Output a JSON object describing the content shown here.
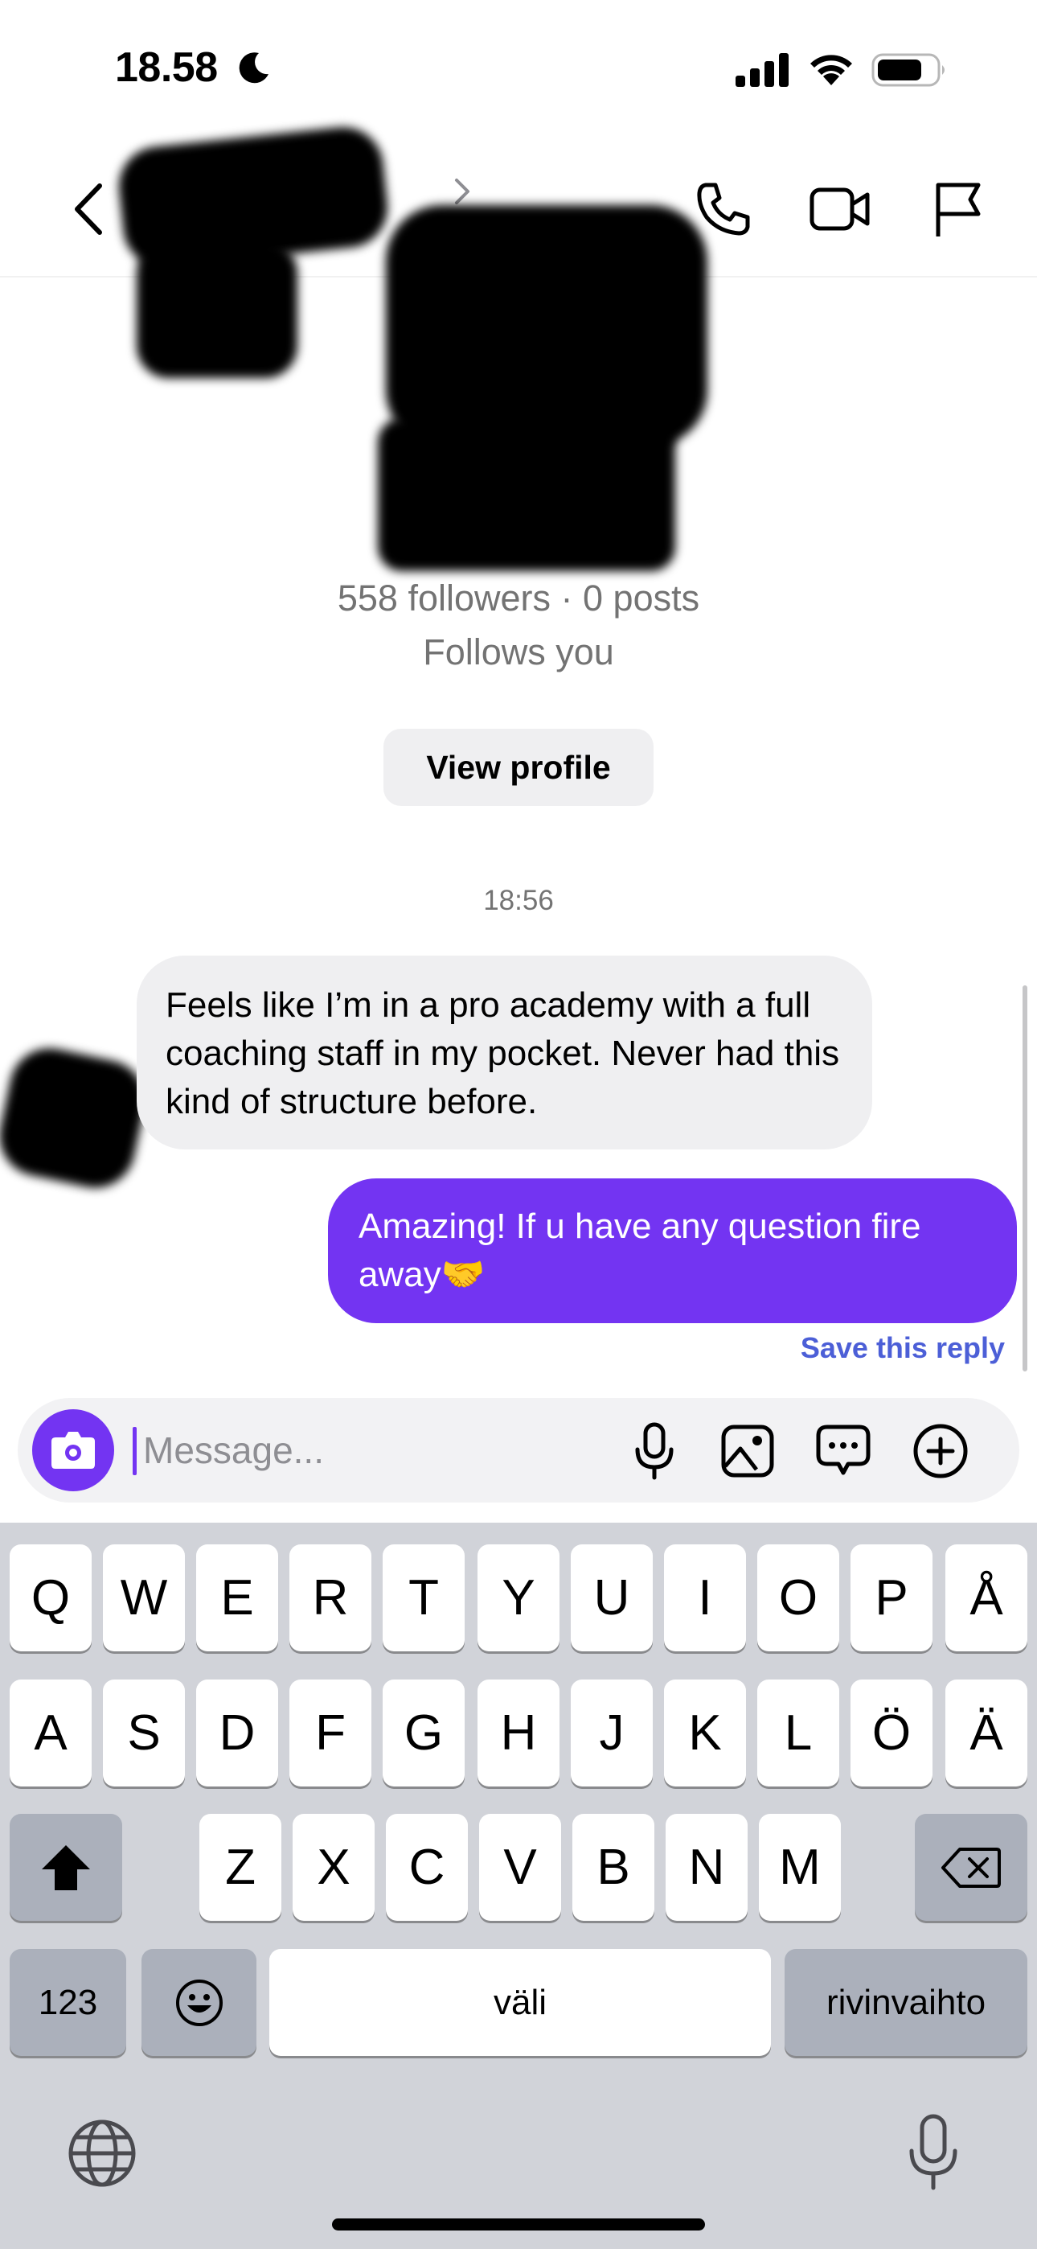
{
  "status_bar": {
    "time": "18.58",
    "icons": [
      "moon-icon",
      "signal-icon",
      "wifi-icon",
      "battery-icon"
    ]
  },
  "header": {
    "icons": [
      "back-chevron-icon",
      "phone-icon",
      "video-camera-icon",
      "flag-icon"
    ]
  },
  "profile": {
    "stats": "558 followers · 0 posts",
    "follows": "Follows you",
    "view_profile_label": "View profile"
  },
  "thread": {
    "timestamp": "18:56",
    "messages": [
      {
        "direction": "incoming",
        "text": "Feels like I’m in a pro academy with a full coaching staff in my pocket. Never had this kind of structure before."
      },
      {
        "direction": "outgoing",
        "text": "Amazing! If u have any question fire away🤝"
      }
    ],
    "save_reply_label": "Save this reply"
  },
  "composer": {
    "placeholder": "Message...",
    "icons": [
      "camera-icon",
      "microphone-icon",
      "gallery-icon",
      "sticker-icon",
      "plus-icon"
    ]
  },
  "keyboard": {
    "row1": [
      "Q",
      "W",
      "E",
      "R",
      "T",
      "Y",
      "U",
      "I",
      "O",
      "P",
      "Å"
    ],
    "row2": [
      "A",
      "S",
      "D",
      "F",
      "G",
      "H",
      "J",
      "K",
      "L",
      "Ö",
      "Ä"
    ],
    "row3": [
      "Z",
      "X",
      "C",
      "V",
      "B",
      "N",
      "M"
    ],
    "numbers_label": "123",
    "space_label": "väli",
    "return_label": "rivinvaihto"
  },
  "colors": {
    "accent_purple": "#7334f2",
    "save_reply_blue": "#4c5fd7",
    "incoming_bubble": "#efeff1",
    "keyboard_bg": "#d1d3d9"
  }
}
